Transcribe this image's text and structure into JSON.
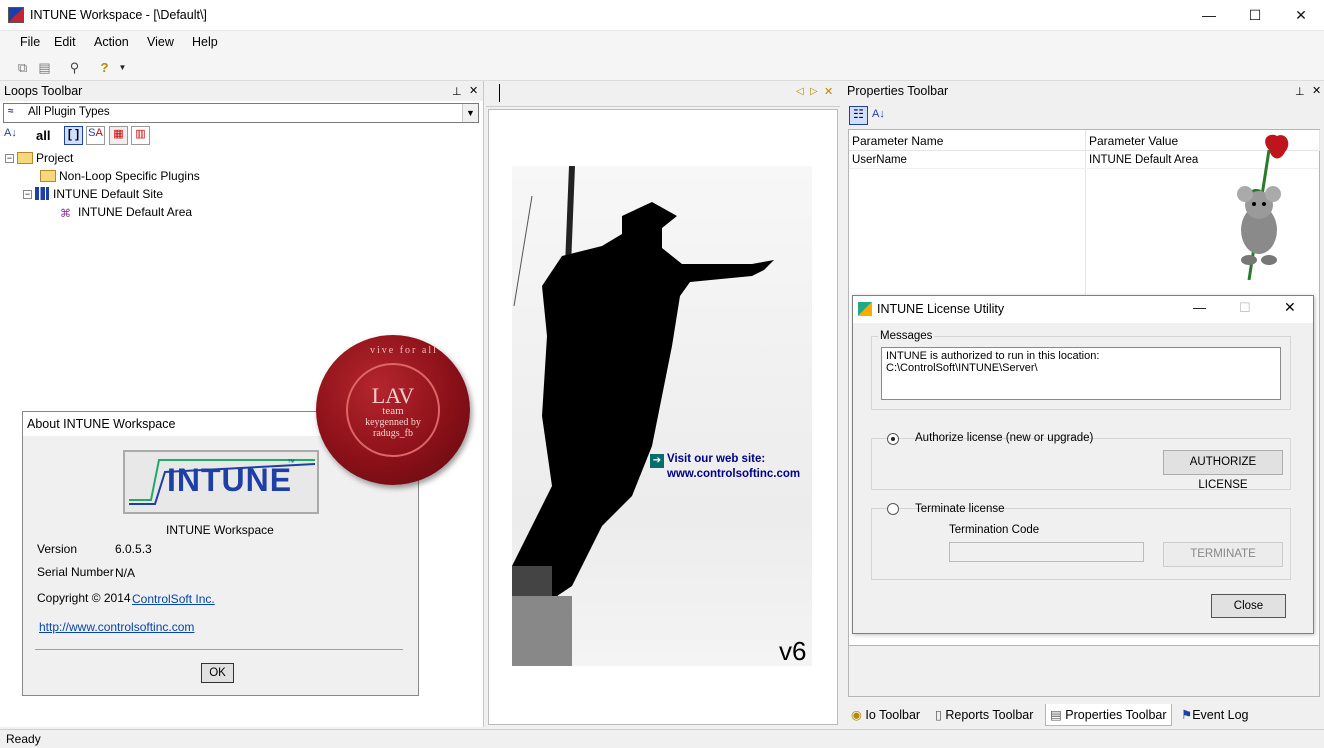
{
  "window": {
    "title": "INTUNE Workspace - [\\Default\\]",
    "minimize": "—",
    "maximize": "☐",
    "close": "✕"
  },
  "menu": [
    "File",
    "Edit",
    "Action",
    "View",
    "Help"
  ],
  "loops": {
    "title": "Loops Toolbar",
    "filter": "All Plugin Types",
    "all_label": "all",
    "tree": [
      "Project",
      "Non-Loop Specific Plugins",
      "INTUNE Default Site",
      "INTUNE Default Area"
    ]
  },
  "about": {
    "title": "About INTUNE Workspace",
    "logo_text": "INTUNE",
    "logo_tm": "™",
    "product": "INTUNE Workspace",
    "version_label": "Version",
    "version": "6.0.5.3",
    "serial_label": "Serial Number",
    "serial": "N/A",
    "copyright": "Copyright © 2014",
    "company": "ControlSoft Inc.",
    "url": "http://www.controlsoftinc.com",
    "ok": "OK"
  },
  "seal": {
    "line1": "LAV",
    "line2": "team",
    "line3": "keygenned by",
    "line4": "radugs_fb",
    "ring": "vive for all"
  },
  "splash": {
    "visit": "Visit our web site:",
    "site": "www.controlsoftinc.com",
    "version": "v6"
  },
  "props": {
    "title": "Properties Toolbar",
    "col1": "Parameter Name",
    "col2": "Parameter Value",
    "rows": [
      {
        "name": "UserName",
        "value": "INTUNE Default Area"
      }
    ]
  },
  "license": {
    "title": "INTUNE License Utility",
    "messages_legend": "Messages",
    "message": "INTUNE is authorized to run in this location:\nC:\\ControlSoft\\INTUNE\\Server\\",
    "authorize_label": "Authorize license (new or upgrade)",
    "authorize_button": "AUTHORIZE LICENSE",
    "terminate_label": "Terminate license",
    "termination_code_label": "Termination Code",
    "termination_code": "",
    "terminate_button": "TERMINATE",
    "close_button": "Close"
  },
  "tabs": [
    "Io Toolbar",
    "Reports Toolbar",
    "Properties Toolbar",
    "Event Log"
  ],
  "status": "Ready"
}
